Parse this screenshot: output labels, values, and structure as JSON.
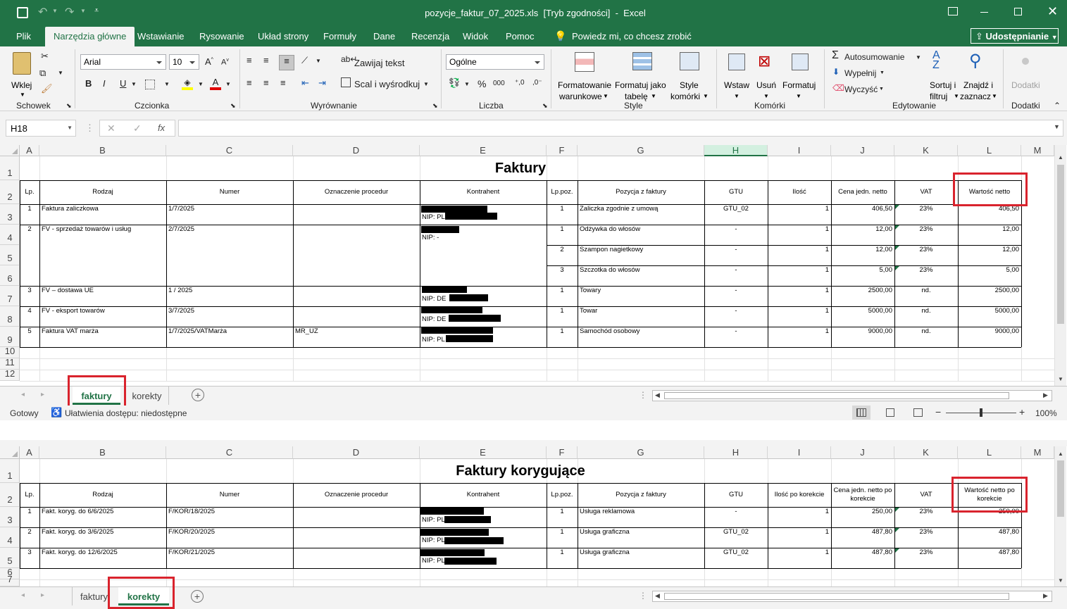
{
  "window": {
    "title": "pozycje_faktur_07_2025.xls  [Tryb zgodności]  -  Excel",
    "accent": "#217346"
  },
  "ribbon_tabs": [
    "Plik",
    "Narzędzia główne",
    "Wstawianie",
    "Rysowanie",
    "Układ strony",
    "Formuły",
    "Dane",
    "Recenzja",
    "Widok",
    "Pomoc"
  ],
  "tell_me": "Powiedz mi, co chcesz zrobić",
  "share": "Udostępnianie",
  "ribbon": {
    "paste": "Wklej",
    "font_name": "Arial",
    "font_size": "10",
    "wrap_text": "Zawijaj tekst",
    "merge_center": "Scal i wyśrodkuj",
    "number_format": "Ogólne",
    "cond_format_1": "Formatowanie",
    "cond_format_2": "warunkowe",
    "format_table_1": "Formatuj jako",
    "format_table_2": "tabelę",
    "cell_styles_1": "Style",
    "cell_styles_2": "komórki",
    "insert": "Wstaw",
    "delete": "Usuń",
    "format": "Formatuj",
    "autosum": "Autosumowanie",
    "fill": "Wypełnij",
    "clear": "Wyczyść",
    "sort_1": "Sortuj i",
    "sort_2": "filtruj",
    "find_1": "Znajdź i",
    "find_2": "zaznacz",
    "addins": "Dodatki",
    "groups": {
      "clipboard": "Schowek",
      "font": "Czcionka",
      "alignment": "Wyrównanie",
      "number": "Liczba",
      "styles": "Style",
      "cells": "Komórki",
      "editing": "Edytowanie",
      "addins": "Dodatki"
    },
    "percent": "%",
    "thousands": "000",
    "bold": "B",
    "italic": "I",
    "underline": "U"
  },
  "formula_bar": {
    "name_box": "H18",
    "fx": "fx",
    "value": ""
  },
  "columns": [
    "A",
    "B",
    "C",
    "D",
    "E",
    "F",
    "G",
    "H",
    "I",
    "J",
    "K",
    "L",
    "M"
  ],
  "sheet1": {
    "title": "Faktury",
    "headers": [
      "Lp.",
      "Rodzaj",
      "Numer",
      "Oznaczenie procedur",
      "Kontrahent",
      "Lp.poz.",
      "Pozycja z faktury",
      "GTU",
      "Ilość",
      "Cena jedn. netto",
      "VAT",
      "Wartość netto"
    ],
    "rows": [
      {
        "lp": "1",
        "rodzaj": "Faktura zaliczkowa",
        "numer": "1/7/2025",
        "proc": "",
        "nip": "NIP: PL",
        "items": [
          {
            "lpp": "1",
            "poz": "Zaliczka zgodnie z umową",
            "gtu": "GTU_02",
            "ilosc": "1",
            "cena": "406,50",
            "vat": "23%",
            "wart": "406,50"
          }
        ]
      },
      {
        "lp": "2",
        "rodzaj": "FV - sprzedaż towarów i usług",
        "numer": "2/7/2025",
        "proc": "",
        "nip": "NIP: -",
        "items": [
          {
            "lpp": "1",
            "poz": "Odżywka do włosów",
            "gtu": "-",
            "ilosc": "1",
            "cena": "12,00",
            "vat": "23%",
            "wart": "12,00"
          },
          {
            "lpp": "2",
            "poz": "Szampon nagietkowy",
            "gtu": "-",
            "ilosc": "1",
            "cena": "12,00",
            "vat": "23%",
            "wart": "12,00"
          },
          {
            "lpp": "3",
            "poz": "Szczotka do włosów",
            "gtu": "-",
            "ilosc": "1",
            "cena": "5,00",
            "vat": "23%",
            "wart": "5,00"
          }
        ]
      },
      {
        "lp": "3",
        "rodzaj": "FV – dostawa UE",
        "numer": "1 / 2025",
        "proc": "",
        "nip": "NIP: DE",
        "items": [
          {
            "lpp": "1",
            "poz": "Towary",
            "gtu": "-",
            "ilosc": "1",
            "cena": "2500,00",
            "vat": "nd.",
            "wart": "2500,00"
          }
        ]
      },
      {
        "lp": "4",
        "rodzaj": "FV - eksport towarów",
        "numer": "3/7/2025",
        "proc": "",
        "nip": "NIP: DE",
        "items": [
          {
            "lpp": "1",
            "poz": "Towar",
            "gtu": "-",
            "ilosc": "1",
            "cena": "5000,00",
            "vat": "nd.",
            "wart": "5000,00"
          }
        ]
      },
      {
        "lp": "5",
        "rodzaj": "Faktura VAT marża",
        "numer": "1/7/2025/VATMarża",
        "proc": "MR_UZ",
        "nip": "NIP: PL",
        "items": [
          {
            "lpp": "1",
            "poz": "Samochód osobowy",
            "gtu": "-",
            "ilosc": "1",
            "cena": "9000,00",
            "vat": "nd.",
            "wart": "9000,00"
          }
        ]
      }
    ],
    "row_numbers": [
      "1",
      "2",
      "3",
      "4",
      "5",
      "6",
      "7",
      "8",
      "9",
      "10",
      "11",
      "12"
    ],
    "tabs": [
      "faktury",
      "korekty"
    ]
  },
  "status": {
    "ready": "Gotowy",
    "accessibility": "Ułatwienia dostępu: niedostępne",
    "zoom": "100%"
  },
  "sheet2": {
    "title": "Faktury korygujące",
    "headers": [
      "Lp.",
      "Rodzaj",
      "Numer",
      "Oznaczenie procedur",
      "Kontrahent",
      "Lp.poz.",
      "Pozycja z faktury",
      "GTU",
      "Ilość po korekcie",
      "Cena jedn. netto po korekcie",
      "VAT",
      "Wartość netto po korekcie"
    ],
    "rows": [
      {
        "lp": "1",
        "rodzaj": "Fakt. koryg. do 6/6/2025",
        "numer": "F/KOR/18/2025",
        "nip": "NIP: PL",
        "lpp": "1",
        "poz": "Usługa reklamowa",
        "gtu": "-",
        "ilosc": "1",
        "cena": "250,00",
        "vat": "23%",
        "wart": "250,00"
      },
      {
        "lp": "2",
        "rodzaj": "Fakt. koryg. do 3/6/2025",
        "numer": "F/KOR/20/2025",
        "nip": "NIP: PL",
        "lpp": "1",
        "poz": "Usługa graficzna",
        "gtu": "GTU_02",
        "ilosc": "1",
        "cena": "487,80",
        "vat": "23%",
        "wart": "487,80"
      },
      {
        "lp": "3",
        "rodzaj": "Fakt. koryg. do 12/6/2025",
        "numer": "F/KOR/21/2025",
        "nip": "NIP: PL",
        "lpp": "1",
        "poz": "Usługa graficzna",
        "gtu": "GTU_02",
        "ilosc": "1",
        "cena": "487,80",
        "vat": "23%",
        "wart": "487,80"
      }
    ],
    "row_numbers": [
      "1",
      "2",
      "3",
      "4",
      "5",
      "6",
      "7"
    ],
    "tabs": [
      "faktury",
      "korekty"
    ]
  }
}
